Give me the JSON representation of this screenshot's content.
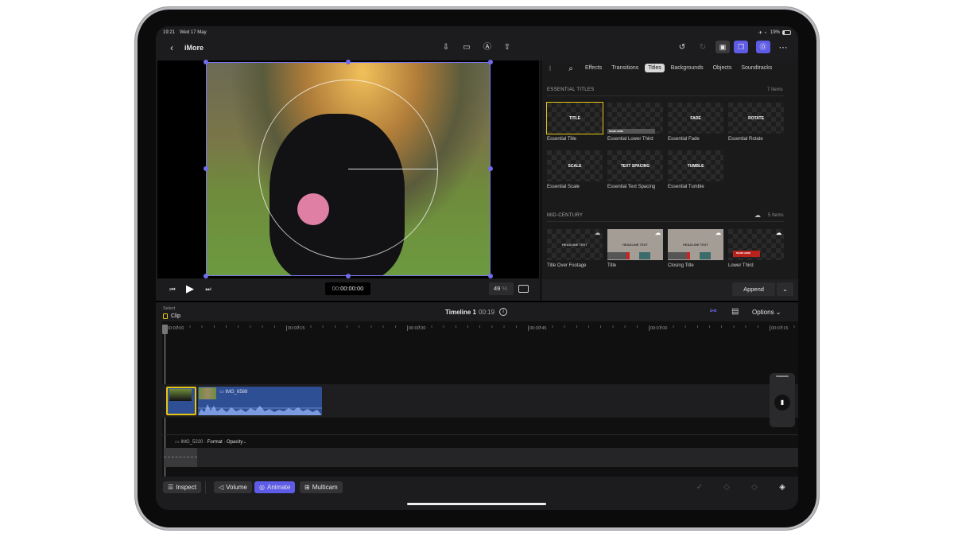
{
  "status_bar": {
    "time": "19:21",
    "date": "Wed 17 May",
    "battery": "19%"
  },
  "top_bar": {
    "back_icon": "chevron-left-icon",
    "project_title": "iMore",
    "center_icons": [
      "import-icon",
      "camera-icon",
      "voiceover-icon",
      "share-icon"
    ],
    "right_icons": [
      "undo-icon",
      "redo-icon",
      "photos-icon",
      "titles-browser-icon",
      "inspector-icon",
      "more-icon"
    ]
  },
  "browser": {
    "tabs": [
      "Effects",
      "Transitions",
      "Titles",
      "Backgrounds",
      "Objects",
      "Soundtracks"
    ],
    "active_tab": "Titles",
    "sections": [
      {
        "title": "ESSENTIAL TITLES",
        "count": "7 Items",
        "items": [
          {
            "label": "Essential Title",
            "thumb": "TITLE"
          },
          {
            "label": "Essential Lower Third",
            "thumb": "NAME HERE"
          },
          {
            "label": "Essential Fade",
            "thumb": "FADE"
          },
          {
            "label": "Essential Rotate",
            "thumb": "ROTATE"
          },
          {
            "label": "Essential Scale",
            "thumb": "SCALE"
          },
          {
            "label": "Essential Text Spacing",
            "thumb": "TEXT SPACING"
          },
          {
            "label": "Essential Tumble",
            "thumb": "TUMBLE"
          }
        ]
      },
      {
        "title": "MID-CENTURY",
        "count": "5 Items",
        "items": [
          {
            "label": "Title Over Footage",
            "thumb": "HEADLINE TEXT"
          },
          {
            "label": "Title",
            "thumb": "HEADLINE TEXT"
          },
          {
            "label": "Closing Title",
            "thumb": "HEADLINE TEXT"
          },
          {
            "label": "Lower Third",
            "thumb": "NAME HERE"
          }
        ]
      }
    ],
    "append_label": "Append"
  },
  "viewer": {
    "timecode_prefix": "00:",
    "timecode": "00:00:00",
    "zoom": "49",
    "zoom_unit": "%"
  },
  "timeline": {
    "select_label": "Select",
    "select_mode": "Clip",
    "name": "Timeline 1",
    "duration": "00:19",
    "options_label": "Options",
    "ruler": [
      "00:00:00",
      "00:00:15",
      "00:00:30",
      "00:00:45",
      "00:01:00",
      "00:01:15"
    ],
    "clip_name": "IMG_6588",
    "lane_label_clip": "IMG_5220",
    "lane_label_param": "Format · Opacity"
  },
  "bottom_bar": {
    "inspect": "Inspect",
    "volume": "Volume",
    "animate": "Animate",
    "multicam": "Multicam"
  },
  "colors": {
    "accent": "#5e5ce6",
    "selection": "#e7c514",
    "clip": "#2f4f95"
  }
}
